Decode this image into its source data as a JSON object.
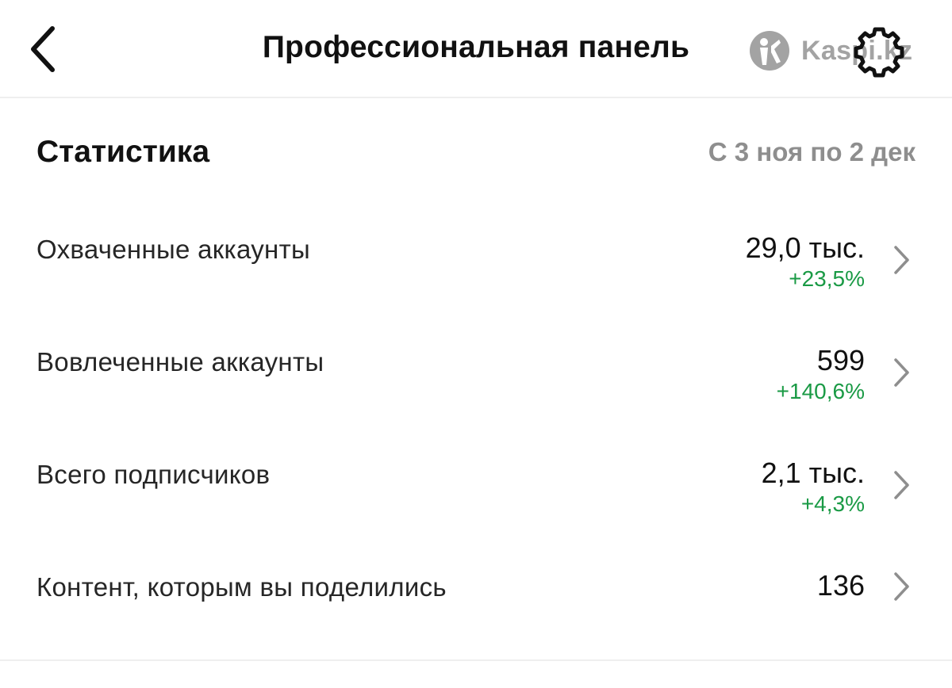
{
  "header": {
    "title": "Профессиональная панель",
    "back_icon": "chevron-left-icon",
    "settings_icon": "gear-icon"
  },
  "watermark": {
    "text": "Kaspi.kz"
  },
  "statistics": {
    "title": "Статистика",
    "date_range": "С 3 ноя по 2 дек",
    "rows": [
      {
        "label": "Охваченные аккаунты",
        "value": "29,0 тыс.",
        "delta": "+23,5%"
      },
      {
        "label": "Вовлеченные аккаунты",
        "value": "599",
        "delta": "+140,6%"
      },
      {
        "label": "Всего подписчиков",
        "value": "2,1 тыс.",
        "delta": "+4,3%"
      },
      {
        "label": "Контент, которым вы поделились",
        "value": "136"
      }
    ]
  },
  "colors": {
    "positive": "#1a9a45",
    "muted": "#8e8e8e",
    "chevron": "#8e8e8e",
    "text": "#111111"
  }
}
